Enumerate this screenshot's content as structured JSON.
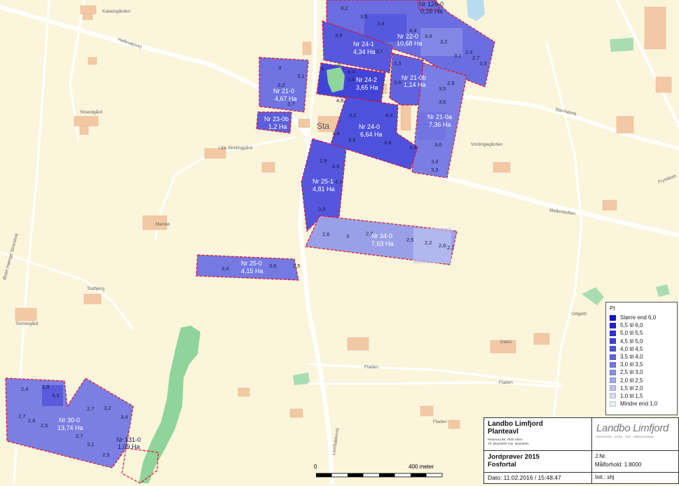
{
  "map": {
    "town_label": "Sta",
    "roads": {
      "hellevejen": "Hellevøjsvej",
      "stenhoj": "Stenhøjvej",
      "mellemtoften": "Mellemtoften",
      "fryndesh": "Fryndesh",
      "fladen": "Fladen",
      "placering1": "Fladen",
      "placering2": "Fladen",
      "vester": "Øster Hænge Strandvej",
      "leerbakkevej": "Leerbakkevej"
    },
    "places": {
      "p1": "Kaladsgården",
      "p2": "Strandgård",
      "p3": "Lille Sindinggård",
      "p4": "Mandø",
      "p5": "Todbjerg",
      "p6": "Tochergård",
      "p7": "Vindingegården",
      "p8": "Odgeth",
      "p9": "Daels"
    }
  },
  "fields": [
    {
      "name": "Nr 126-0",
      "area": "0,16 Ha"
    },
    {
      "name": "Nr 22-0",
      "area": "10,68 Ha"
    },
    {
      "name": "Nr 24-1",
      "area": "4,34 Ha"
    },
    {
      "name": "Nr 21-0b",
      "area": "1,14 Ha"
    },
    {
      "name": "Nr 24-2",
      "area": "3,65 Ha"
    },
    {
      "name": "Nr 21-0",
      "area": "4,67 Ha"
    },
    {
      "name": "Nr 23-0b",
      "area": "1,2 Ha"
    },
    {
      "name": "Nr 21-0a",
      "area": "7,36 Ha"
    },
    {
      "name": "Nr 24-0",
      "area": "6,64 Ha"
    },
    {
      "name": "Nr 25-1",
      "area": "4,81 Ha"
    },
    {
      "name": "Nr 34-0",
      "area": "7,63 Ha"
    },
    {
      "name": "Nr 25-0",
      "area": "4,15 Ha"
    },
    {
      "name": "Nr 30-0",
      "area": "13,74 Ha"
    },
    {
      "name": "Nr 131-0",
      "area": "1,09 Ha"
    }
  ],
  "sample_values": [
    "3,2",
    "3,5",
    "3,4",
    "4,4",
    "3,4",
    "3,2",
    "3,9",
    "3,7",
    "3,3",
    "3,1",
    "2,4",
    "2,7",
    "3,3",
    "3",
    "3,1",
    "3,2",
    "3,7",
    "4",
    "4,4",
    "3,5",
    "3,6",
    "2,9",
    "3,5",
    "3,6",
    "3,3",
    "4,4",
    "3,4",
    "3,9",
    "3,4",
    "4,6",
    "4,4",
    "3,6",
    "3,3",
    "3,3",
    "2,9",
    "4,8",
    "4,1",
    "3,8",
    "2,6",
    "3",
    "2,7",
    "2,5",
    "2,2",
    "2,6",
    "2,7",
    "3,4",
    "3,6",
    "2,5",
    "2,4",
    "2,9",
    "4,3",
    "2,7",
    "2,6",
    "2,5",
    "2,7",
    "3,2",
    "3,4",
    "2,7",
    "3,1",
    "2,5"
  ],
  "legend": {
    "title": "Pt",
    "items": [
      {
        "label": "Større end 6,0",
        "color": "#1414c8"
      },
      {
        "label": "5,5 til 6,0",
        "color": "#2323d2"
      },
      {
        "label": "5,0 til 5,5",
        "color": "#3232d8"
      },
      {
        "label": "4,5 til 5,0",
        "color": "#4141dc"
      },
      {
        "label": "4,0 til 4,5",
        "color": "#5050e0"
      },
      {
        "label": "3,5 til 4,0",
        "color": "#6262e2"
      },
      {
        "label": "3,0 til 3,5",
        "color": "#7777e4"
      },
      {
        "label": "2,5 til 3,0",
        "color": "#8c8ee6"
      },
      {
        "label": "2,0 til 2,5",
        "color": "#a3a8ea"
      },
      {
        "label": "1,5 til 2,0",
        "color": "#bcc2ee"
      },
      {
        "label": "1,0 til 1,5",
        "color": "#d3dbf2"
      },
      {
        "label": "Mindre end 1,0",
        "color": "#e4f1f4"
      }
    ]
  },
  "titleblock": {
    "org_line1": "Landbo Limfjord",
    "org_line2": "Planteavl",
    "address_line1": "Resenvej 85, 7800 Skive",
    "address_line2": "Tlf. 96163000 Fax. 96163001",
    "logo": "Landbo Limfjord",
    "logo_sub": "REVISION · JURA · IKR · RÅDGIVNING",
    "project_line1": "Jordprøver 2015",
    "project_line2": "Fosfortal",
    "date": "Dato: 11.02.2016 / 15:48:47",
    "jnr": "J.Nr.",
    "scale": "Målforhold: 1:8000",
    "init": "Init.: shj"
  },
  "scalebar": {
    "start": "0",
    "end": "400 meter"
  },
  "colors": {
    "background": "#fbf5dc",
    "road": "#ffffff",
    "boundary": "#e0102a",
    "building": "#f2c9a4",
    "green": "#8fd49a"
  }
}
